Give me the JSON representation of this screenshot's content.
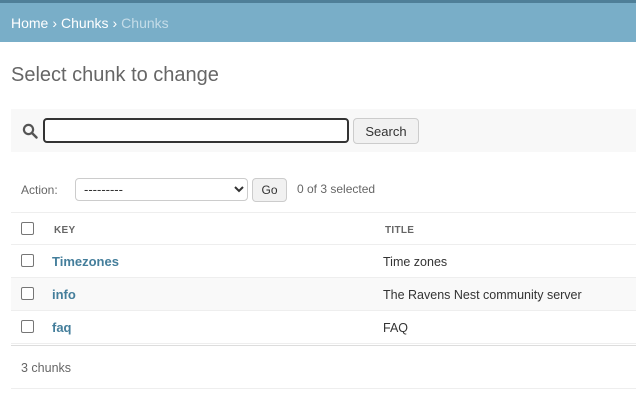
{
  "breadcrumbs": {
    "home": "Home",
    "app": "Chunks",
    "separator": "›",
    "current": "Chunks"
  },
  "page_title": "Select chunk to change",
  "search": {
    "value": "",
    "button_label": "Search",
    "icon": "search-icon"
  },
  "actions": {
    "label": "Action:",
    "selected_option": "---------",
    "go_label": "Go",
    "counter": "0 of 3 selected"
  },
  "table": {
    "columns": [
      "KEY",
      "TITLE"
    ],
    "rows": [
      {
        "key": "Timezones",
        "title": "Time zones"
      },
      {
        "key": "info",
        "title": "The Ravens Nest community server"
      },
      {
        "key": "faq",
        "title": "FAQ"
      }
    ]
  },
  "paginator": "3 chunks",
  "colors": {
    "header_bg": "#79aec8",
    "header_topline": "#4f7f98",
    "link": "#447e9b"
  }
}
